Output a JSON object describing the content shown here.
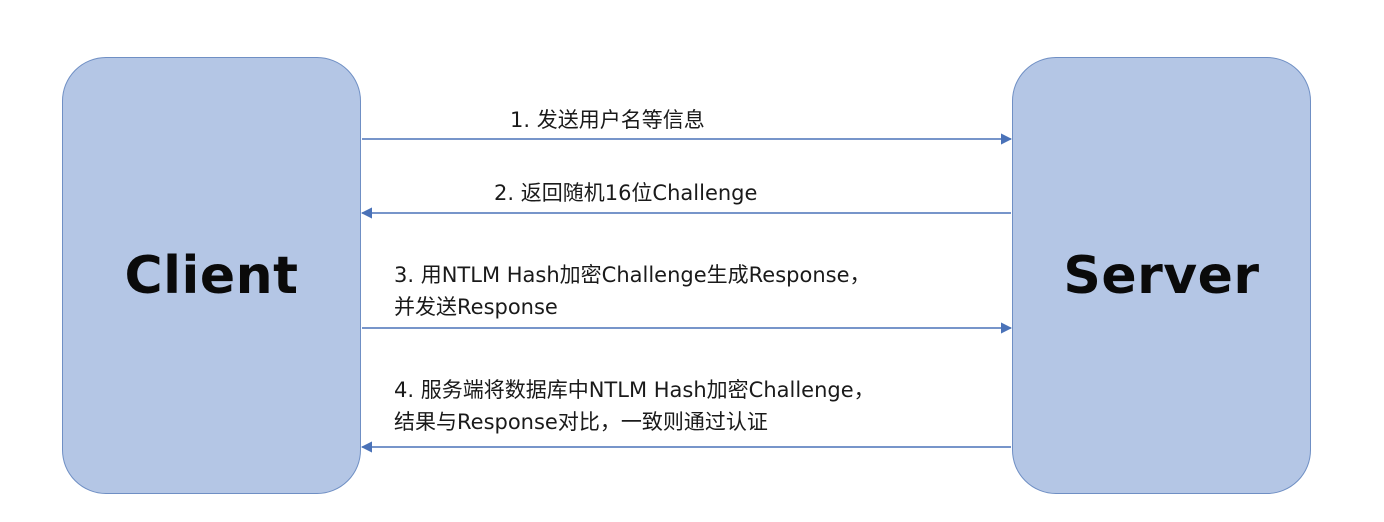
{
  "client": {
    "label": "Client"
  },
  "server": {
    "label": "Server"
  },
  "messages": [
    {
      "direction": "client-to-server",
      "lines": [
        "1. 发送用户名等信息"
      ]
    },
    {
      "direction": "server-to-client",
      "lines": [
        "2. 返回随机16位Challenge"
      ]
    },
    {
      "direction": "client-to-server",
      "lines": [
        "3. 用NTLM Hash加密Challenge生成Response，",
        "并发送Response"
      ]
    },
    {
      "direction": "server-to-client",
      "lines": [
        "4. 服务端将数据库中NTLM Hash加密Challenge，",
        "结果与Response对比，一致则通过认证"
      ]
    }
  ],
  "colors": {
    "box_fill": "#b4c6e5",
    "box_border": "#6f8fc4",
    "arrow": "#4a72b8",
    "text": "#1a1a1a"
  }
}
